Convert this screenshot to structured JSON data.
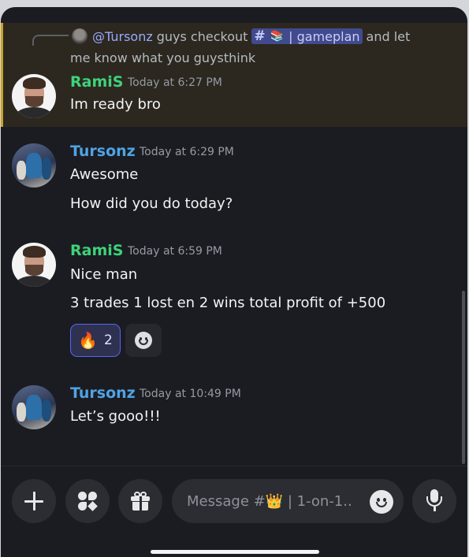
{
  "reply": {
    "mention": "@Tursonz",
    "text_before": "guys checkout",
    "channel_hash": "#",
    "channel_emoji": "📚",
    "channel_name": "| gameplan",
    "text_after": "and let",
    "line2": "me know what you guysthink"
  },
  "messages": [
    {
      "author": "RamiS",
      "time": "Today at 6:27 PM",
      "lines": [
        "Im ready bro"
      ]
    },
    {
      "author": "Tursonz",
      "time": "Today at 6:29 PM",
      "lines": [
        "Awesome",
        "How did you do today?"
      ]
    },
    {
      "author": "RamiS",
      "time": "Today at 6:59 PM",
      "lines": [
        "Nice man",
        "3 trades 1 lost en 2 wins total profit of +500"
      ],
      "reaction": {
        "emoji": "🔥",
        "count": "2"
      }
    },
    {
      "author": "Tursonz",
      "time": "Today at 10:49 PM",
      "lines": [
        "Let’s gooo!!!"
      ]
    }
  ],
  "composer": {
    "placeholder": "Message #👑 | 1-on-1.."
  },
  "colors": {
    "background": "#1b1c21",
    "mention_highlight": "#2c281f",
    "mention_bar": "#c9a227",
    "rami_name": "#3ed27a",
    "tursonz_name": "#4fa3e6",
    "channel_pill": "#414a8c",
    "reaction_border": "#5865f2"
  },
  "icons": [
    "plus-icon",
    "apps-icon",
    "gift-icon",
    "emoji-icon",
    "microphone-icon",
    "add-reaction-icon"
  ]
}
